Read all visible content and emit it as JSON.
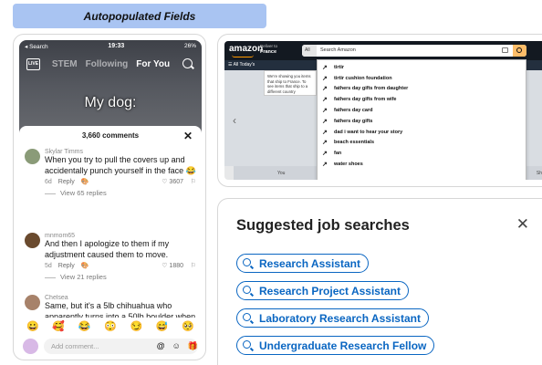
{
  "header": {
    "title": "Autopopulated Fields"
  },
  "phone": {
    "status": {
      "left": "◂ Search",
      "time": "19:33",
      "right": "26%"
    },
    "live_label": "LIVE",
    "tabs": [
      "STEM",
      "Following",
      "For You"
    ],
    "active_tab": "For You",
    "caption": "My dog:",
    "comments_count": "3,660 comments",
    "close": "✕",
    "comments": [
      {
        "user": "Skylar Timms",
        "text": "When you try to pull the covers up and accidentally punch yourself in the face 😂",
        "age": "6d",
        "reply": "Reply",
        "likes": "♡ 3607",
        "view_replies": "View 65 replies",
        "avatar_color": "#8a9b78"
      },
      {
        "user": "mnmom65",
        "text": "And then I apologize to them if my adjustment caused them to move.",
        "age": "5d",
        "reply": "Reply",
        "likes": "♡ 1880",
        "view_replies": "View 21 replies",
        "avatar_color": "#6a4a2e"
      },
      {
        "user": "Chelsea",
        "text": "Same, but it's a 5lb chihuahua who apparently turns into a 50lb boulder when",
        "avatar_color": "#a7826a"
      }
    ],
    "emojis": [
      "😀",
      "🥰",
      "😂",
      "😳",
      "😏",
      "😅",
      "🥺"
    ],
    "comment_placeholder": "Add comment...",
    "input_icons": [
      "@",
      "☺",
      "🎁"
    ]
  },
  "amazon": {
    "logo": "amazon",
    "deliver_to_label": "Deliver to",
    "deliver_to_country": "France",
    "category": "All",
    "search_placeholder": "Search Amazon",
    "nav_all": "☰ All  Today's",
    "popup_text": "We're showing you items that ship to France. To see items that ship to a different country",
    "strip_left": "You",
    "strip_right": "Sh",
    "suggestions": [
      "tirtir",
      "tirtir cushion foundation",
      "fathers day gifts from daughter",
      "fathers day gifts from wife",
      "fathers day card",
      "fathers day gifts",
      "dad i want to hear your story",
      "beach essentials",
      "fan",
      "water shoes"
    ]
  },
  "jobs": {
    "title": "Suggested job searches",
    "close": "✕",
    "suggestions": [
      "Research Assistant",
      "Research Project Assistant",
      "Laboratory Research Assistant",
      "Undergraduate Research Fellow"
    ]
  },
  "colors": {
    "header_bg": "#a9c4f2",
    "linkedin_blue": "#0a66c2",
    "amazon_dark": "#131921",
    "amazon_orange": "#febd69"
  }
}
